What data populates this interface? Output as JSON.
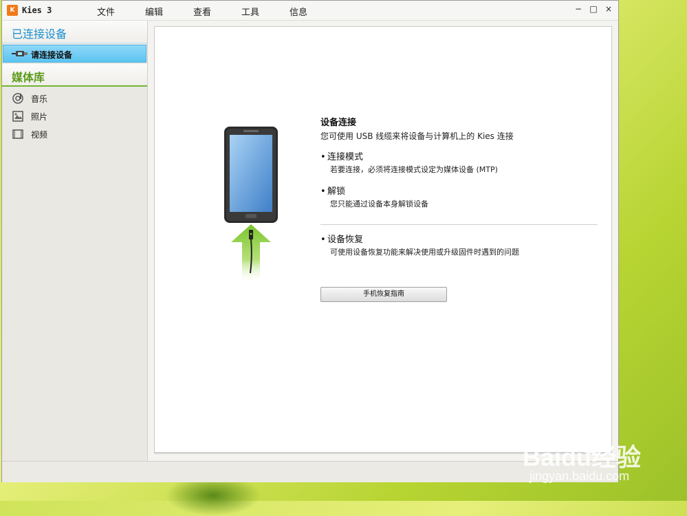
{
  "window": {
    "logo_text": "K",
    "title": "Kies 3",
    "menu": [
      "文件",
      "编辑",
      "查看",
      "工具",
      "信息"
    ],
    "controls": {
      "minimize": "−",
      "maximize": "□",
      "close": "×"
    }
  },
  "sidebar": {
    "connected_header": "已连接设备",
    "device_item": "请连接设备",
    "library_header": "媒体库",
    "library_items": [
      {
        "label": "音乐",
        "icon": "music-icon"
      },
      {
        "label": "照片",
        "icon": "photo-icon"
      },
      {
        "label": "视频",
        "icon": "video-icon"
      }
    ]
  },
  "content": {
    "title": "设备连接",
    "description": "您可使用 USB 线缆来将设备与计算机上的 Kies 连接",
    "bullet_char": "•",
    "bullets": [
      {
        "title": "连接模式",
        "sub": "若要连接，必须将连接模式设定为媒体设备 (MTP)"
      },
      {
        "title": "解锁",
        "sub": "您只能通过设备本身解锁设备"
      },
      {
        "title": "设备恢复",
        "sub": "可使用设备恢复功能来解决使用或升级固件时遇到的问题"
      }
    ],
    "button_label": "手机恢复指南"
  },
  "watermark": {
    "logo": "Baidu经验",
    "url": "jingyan.baidu.com"
  },
  "colors": {
    "accent_blue": "#1a8fd0",
    "accent_green": "#5a9a18",
    "selection": "#5cc4f1"
  }
}
